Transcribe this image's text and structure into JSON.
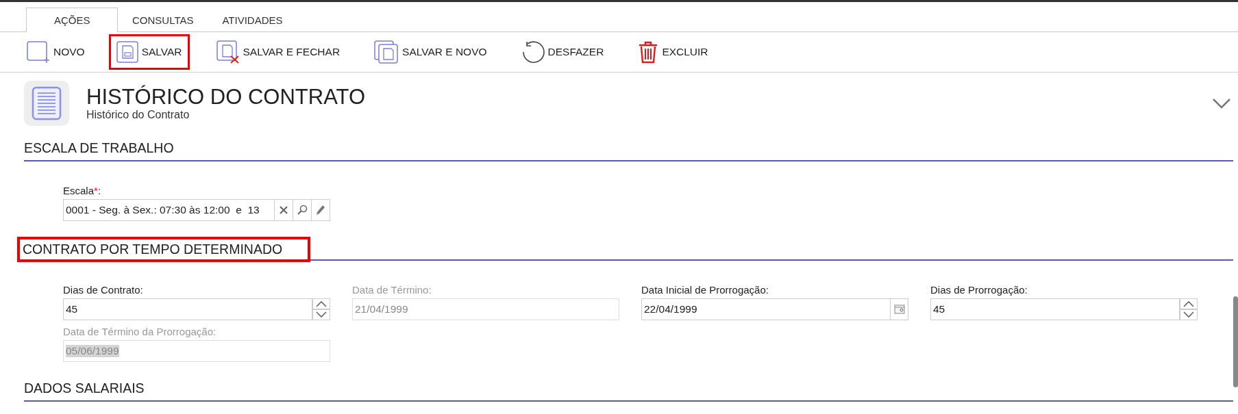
{
  "tabs": [
    {
      "label": "AÇÕES",
      "selected": true
    },
    {
      "label": "CONSULTAS",
      "selected": false
    },
    {
      "label": "ATIVIDADES",
      "selected": false
    }
  ],
  "toolbar": [
    {
      "kind": "new",
      "label": "NOVO",
      "highlighted": false
    },
    {
      "kind": "save",
      "label": "SALVAR",
      "highlighted": true
    },
    {
      "kind": "save_close",
      "label": "SALVAR E FECHAR",
      "highlighted": false
    },
    {
      "kind": "save_new",
      "label": "SALVAR E NOVO",
      "highlighted": false
    },
    {
      "kind": "undo",
      "label": "DESFAZER",
      "highlighted": false
    },
    {
      "kind": "delete",
      "label": "EXCLUIR",
      "highlighted": false
    }
  ],
  "header": {
    "title": "HISTÓRICO DO CONTRATO",
    "subtitle": "Histórico do Contrato",
    "expanded": false
  },
  "sections": [
    {
      "title": "ESCALA DE TRABALHO",
      "highlighted": false,
      "rows": [
        [
          {
            "kind": "lookup",
            "label": "Escala",
            "required_mark": "*",
            "label_end": ":",
            "value": "0001 - Seg. à Sex.: 07:30 às 12:00  e  13",
            "disabled": false,
            "text_selected": false
          }
        ]
      ]
    },
    {
      "title": "CONTRATO POR TEMPO DETERMINADO",
      "highlighted": true,
      "rows": [
        [
          {
            "kind": "spinner",
            "label": "Dias de Contrato:",
            "value": "45",
            "disabled": false,
            "text_selected": false
          },
          {
            "kind": "text",
            "label": "Data de Término:",
            "value": "21/04/1999",
            "disabled": true,
            "text_selected": false
          },
          {
            "kind": "date",
            "label": "Data Inicial de Prorrogação:",
            "value": "22/04/1999",
            "disabled": false,
            "text_selected": false
          },
          {
            "kind": "spinner",
            "label": "Dias de Prorrogação:",
            "value": "45",
            "disabled": false,
            "text_selected": false
          }
        ],
        [
          {
            "kind": "text",
            "label": "Data de Término da Prorrogação:",
            "value": "05/06/1999",
            "disabled": true,
            "text_selected": true
          }
        ]
      ]
    },
    {
      "title": "DADOS SALARIAIS",
      "highlighted": false
    }
  ]
}
